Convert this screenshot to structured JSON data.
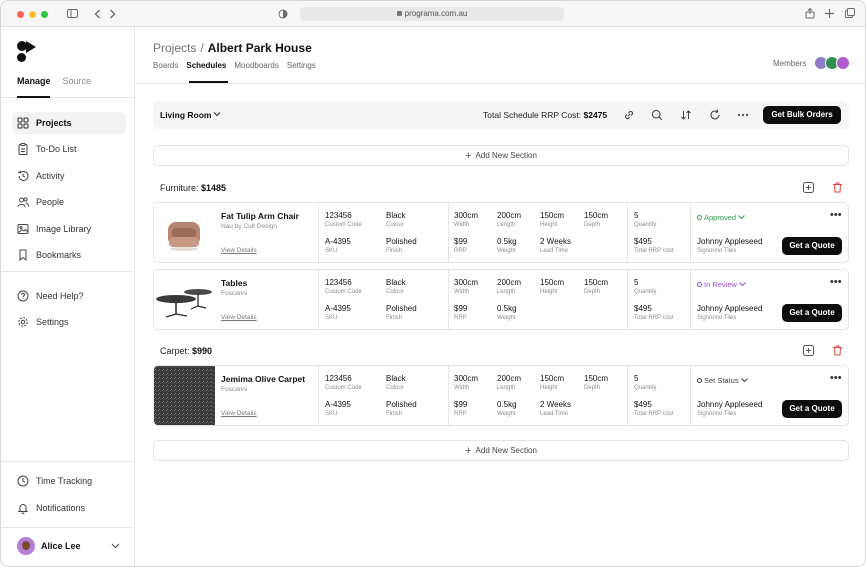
{
  "browser": {
    "url": "programa.com.au"
  },
  "sidebar": {
    "tabs": [
      "Manage",
      "Source"
    ],
    "nav_main": [
      {
        "label": "Projects",
        "icon": "grid-icon"
      },
      {
        "label": "To-Do List",
        "icon": "clipboard-icon"
      },
      {
        "label": "Activity",
        "icon": "history-icon"
      },
      {
        "label": "People",
        "icon": "people-icon"
      },
      {
        "label": "Image Library",
        "icon": "image-icon"
      },
      {
        "label": "Bookmarks",
        "icon": "bookmark-icon"
      }
    ],
    "nav_help": [
      {
        "label": "Need Help?",
        "icon": "help-icon"
      },
      {
        "label": "Settings",
        "icon": "gear-icon"
      }
    ],
    "nav_bottom": [
      {
        "label": "Time Tracking",
        "icon": "clock-icon"
      },
      {
        "label": "Notifications",
        "icon": "bell-icon"
      }
    ],
    "user": {
      "name": "Alice Lee"
    }
  },
  "header": {
    "breadcrumb_root": "Projects",
    "breadcrumb_sep": "/",
    "title": "Albert Park House",
    "tabs": [
      "Boards",
      "Schedules",
      "Moodboards",
      "Settings"
    ],
    "members_label": "Members"
  },
  "room_bar": {
    "room": "Living Room",
    "total_label": "Total Schedule RRP Cost:",
    "total_value": "$2475",
    "bulk_button": "Get Bulk Orders"
  },
  "add_section_label": "Add New Section",
  "sections": [
    {
      "title": "Furniture:",
      "total": "$1485",
      "items": [
        {
          "name": "Fat Tulip Arm Chair",
          "brand": "Nau by Cult Design",
          "link": "View Details",
          "custom_code": "123456",
          "custom_code_label": "Custom Code",
          "colour": "Black",
          "colour_label": "Colour",
          "sku": "A-4395",
          "sku_label": "SKU",
          "finish": "Polished",
          "finish_label": "Finish",
          "width": "300cm",
          "width_label": "Width",
          "length": "200cm",
          "length_label": "Length",
          "height": "150cm",
          "height_label": "Height",
          "depth": "150cm",
          "depth_label": "Depth",
          "rrp": "$99",
          "rrp_label": "RRP",
          "weight": "0.5kg",
          "weight_label": "Weight",
          "lead_time": "2 Weeks",
          "lead_time_label": "Lead Time",
          "quantity": "5",
          "quantity_label": "Quantity",
          "total_rrp": "$495",
          "total_rrp_label": "Total RRP cost",
          "status": "Approved",
          "status_color": "#2e9e4f",
          "supplier": "Johnny Appleseed",
          "supplier_co": "Signorino Tiles",
          "quote_button": "Get a Quote"
        },
        {
          "name": "Tables",
          "brand": "Foscarini",
          "link": "View Details",
          "custom_code": "123456",
          "custom_code_label": "Custom Code",
          "colour": "Black",
          "colour_label": "Colour",
          "sku": "A-4395",
          "sku_label": "SKU",
          "finish": "Polished",
          "finish_label": "Finish",
          "width": "300cm",
          "width_label": "Width",
          "length": "200cm",
          "length_label": "Length",
          "height": "150cm",
          "height_label": "Height",
          "depth": "150cm",
          "depth_label": "Depth",
          "rrp": "$99",
          "rrp_label": "RRP",
          "weight": "0.5kg",
          "weight_label": "Weight",
          "quantity": "5",
          "quantity_label": "Quantity",
          "total_rrp": "$495",
          "total_rrp_label": "Total RRP cost",
          "status": "In Review",
          "status_color": "#a04fd6",
          "supplier": "Johnny Appleseed",
          "supplier_co": "Signorino Tiles",
          "quote_button": "Get a Quote"
        }
      ]
    },
    {
      "title": "Carpet:",
      "total": "$990",
      "items": [
        {
          "name": "Jemima Olive Carpet",
          "brand": "Foscarini",
          "link": "View Details",
          "custom_code": "123456",
          "custom_code_label": "Custom Code",
          "colour": "Black",
          "colour_label": "Colour",
          "sku": "A-4395",
          "sku_label": "SKU",
          "finish": "Polished",
          "finish_label": "Finish",
          "width": "300cm",
          "width_label": "Width",
          "length": "200cm",
          "length_label": "Length",
          "height": "150cm",
          "height_label": "Height",
          "depth": "150cm",
          "depth_label": "Depth",
          "rrp": "$99",
          "rrp_label": "RRP",
          "weight": "0.5kg",
          "weight_label": "Weight",
          "lead_time": "2 Weeks",
          "lead_time_label": "Lead Time",
          "quantity": "5",
          "quantity_label": "Quantity",
          "total_rrp": "$495",
          "total_rrp_label": "Total RRP cost",
          "status": "Set Status",
          "status_color": "#444444",
          "supplier": "Johnny Appleseed",
          "supplier_co": "Signorino Tiles",
          "quote_button": "Get a Quote"
        }
      ]
    }
  ]
}
